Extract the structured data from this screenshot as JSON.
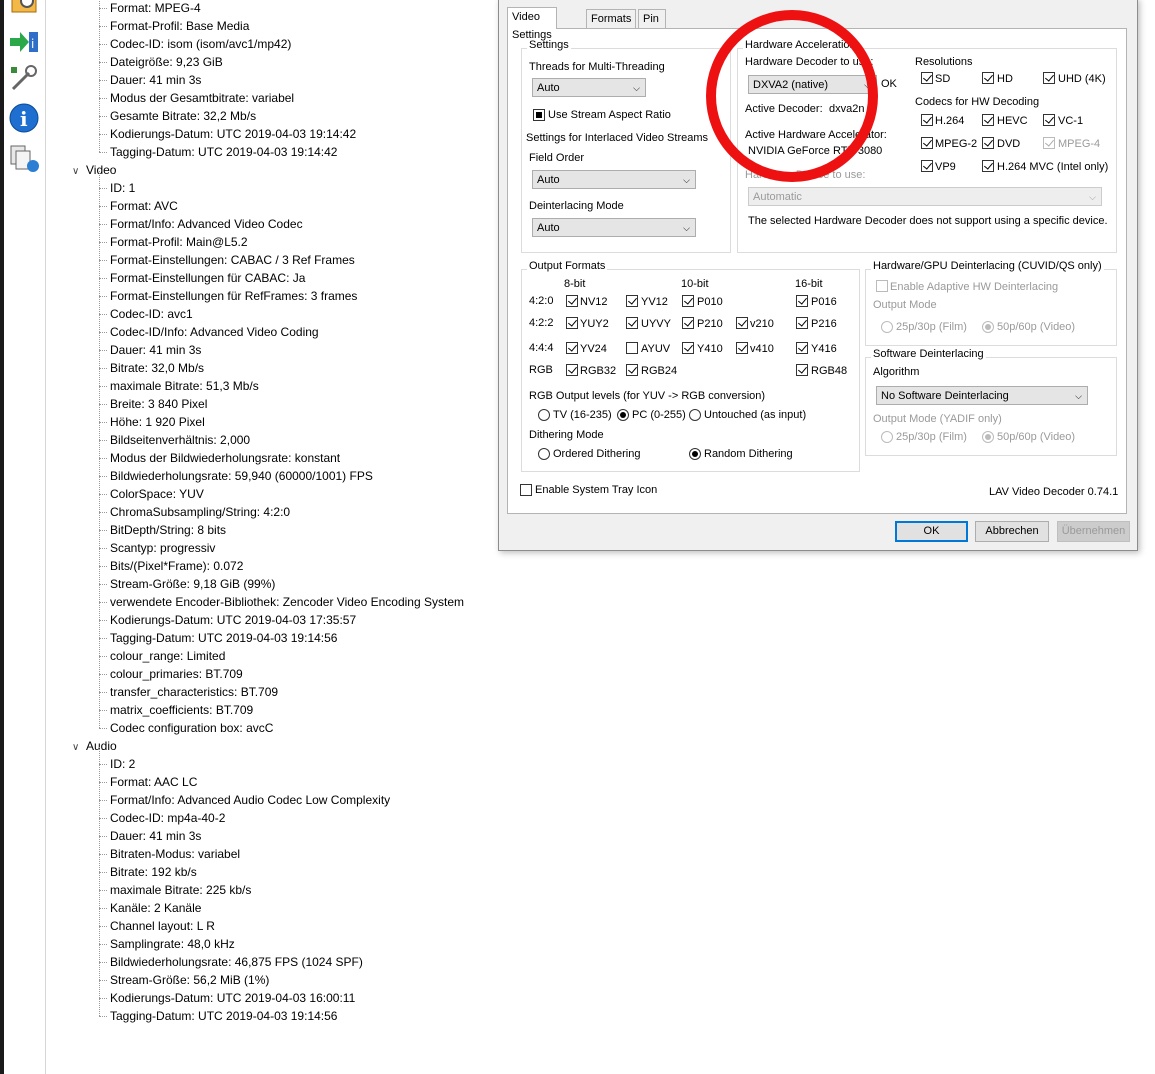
{
  "tree": {
    "general_items": [
      "Format: MPEG-4",
      "Format-Profil: Base Media",
      "Codec-ID: isom (isom/avc1/mp42)",
      "Dateigröße: 9,23 GiB",
      "Dauer: 41 min 3s",
      "Modus der Gesamtbitrate: variabel",
      "Gesamte Bitrate: 32,2 Mb/s",
      "Kodierungs-Datum: UTC 2019-04-03 19:14:42",
      "Tagging-Datum: UTC 2019-04-03 19:14:42"
    ],
    "video_label": "Video",
    "video_items": [
      "ID: 1",
      "Format: AVC",
      "Format/Info: Advanced Video Codec",
      "Format-Profil: Main@L5.2",
      "Format-Einstellungen: CABAC / 3 Ref Frames",
      "Format-Einstellungen für CABAC: Ja",
      "Format-Einstellungen für RefFrames: 3 frames",
      "Codec-ID: avc1",
      "Codec-ID/Info: Advanced Video Coding",
      "Dauer: 41 min 3s",
      "Bitrate: 32,0 Mb/s",
      "maximale Bitrate: 51,3 Mb/s",
      "Breite: 3 840 Pixel",
      "Höhe: 1 920 Pixel",
      "Bildseitenverhältnis: 2,000",
      "Modus der Bildwiederholungsrate: konstant",
      "Bildwiederholungsrate: 59,940 (60000/1001) FPS",
      "ColorSpace: YUV",
      "ChromaSubsampling/String: 4:2:0",
      "BitDepth/String: 8 bits",
      "Scantyp: progressiv",
      "Bits/(Pixel*Frame): 0.072",
      "Stream-Größe: 9,18 GiB (99%)",
      "verwendete Encoder-Bibliothek: Zencoder Video Encoding System",
      "Kodierungs-Datum: UTC 2019-04-03 17:35:57",
      "Tagging-Datum: UTC 2019-04-03 19:14:56",
      "colour_range: Limited",
      "colour_primaries: BT.709",
      "transfer_characteristics: BT.709",
      "matrix_coefficients: BT.709",
      "Codec configuration box: avcC"
    ],
    "audio_label": "Audio",
    "audio_items": [
      "ID: 2",
      "Format: AAC LC",
      "Format/Info: Advanced Audio Codec Low Complexity",
      "Codec-ID: mp4a-40-2",
      "Dauer: 41 min 3s",
      "Bitraten-Modus: variabel",
      "Bitrate: 192 kb/s",
      "maximale Bitrate: 225 kb/s",
      "Kanäle: 2 Kanäle",
      "Channel layout: L R",
      "Samplingrate: 48,0 kHz",
      "Bildwiederholungsrate: 46,875 FPS (1024 SPF)",
      "Stream-Größe: 56,2 MiB (1%)",
      "Kodierungs-Datum: UTC 2019-04-03 16:00:11",
      "Tagging-Datum: UTC 2019-04-03 19:14:56"
    ]
  },
  "dialog": {
    "tabs": [
      "Video Settings",
      "Formats",
      "Pin Info"
    ],
    "settings": {
      "title": "Settings",
      "threads_label": "Threads for Multi-Threading",
      "threads_value": "Auto",
      "stream_aspect_label": "Use Stream Aspect Ratio",
      "interlaced_label": "Settings for Interlaced Video Streams",
      "field_order_label": "Field Order",
      "field_order_value": "Auto",
      "deint_mode_label": "Deinterlacing Mode",
      "deint_mode_value": "Auto"
    },
    "hwaccel": {
      "title": "Hardware Acceleration",
      "decoder_label": "Hardware Decoder to use:",
      "decoder_value": "DXVA2 (native)",
      "ok_status": "OK",
      "active_decoder_label": "Active Decoder:",
      "active_decoder_value": "dxva2n",
      "active_accel_label": "Active Hardware Accelerator:",
      "active_accel_value": "NVIDIA GeForce RTX 3080",
      "device_label": "Hardware Device to use:",
      "device_value": "Automatic",
      "note": "The selected Hardware Decoder does not support using a specific device.",
      "resolutions_label": "Resolutions",
      "resolutions": [
        "SD",
        "HD",
        "UHD (4K)"
      ],
      "codecs_label": "Codecs for HW Decoding",
      "codecs": [
        "H.264",
        "HEVC",
        "VC-1",
        "MPEG-2",
        "DVD",
        "MPEG-4",
        "VP9",
        "H.264 MVC (Intel only)"
      ]
    },
    "output_formats": {
      "title": "Output Formats",
      "headers": [
        "8-bit",
        "10-bit",
        "16-bit"
      ],
      "row_labels": [
        "4:2:0",
        "4:2:2",
        "4:4:4",
        "RGB"
      ],
      "fmts": [
        "NV12",
        "YV12",
        "P010",
        "P016",
        "YUY2",
        "UYVY",
        "P210",
        "v210",
        "P216",
        "YV24",
        "AYUV",
        "Y410",
        "v410",
        "Y416",
        "RGB32",
        "RGB24",
        "RGB48"
      ],
      "rgb_levels_label": "RGB Output levels (for YUV -> RGB conversion)",
      "rgb_levels": [
        "TV (16-235)",
        "PC (0-255)",
        "Untouched (as input)"
      ],
      "dither_label": "Dithering Mode",
      "dither": [
        "Ordered Dithering",
        "Random Dithering"
      ]
    },
    "hw_deint": {
      "title": "Hardware/GPU Deinterlacing (CUVID/QS only)",
      "adaptive_label": "Enable Adaptive HW Deinterlacing",
      "output_mode_label": "Output Mode",
      "options": [
        "25p/30p (Film)",
        "50p/60p (Video)"
      ]
    },
    "sw_deint": {
      "title": "Software Deinterlacing",
      "algorithm_label": "Algorithm",
      "algorithm_value": "No Software Deinterlacing",
      "output_mode_label": "Output Mode (YADIF only)",
      "options": [
        "25p/30p (Film)",
        "50p/60p (Video)"
      ]
    },
    "tray_label": "Enable System Tray Icon",
    "version": "LAV Video Decoder 0.74.1",
    "buttons": {
      "ok": "OK",
      "cancel": "Abbrechen",
      "apply": "Übernehmen"
    }
  }
}
